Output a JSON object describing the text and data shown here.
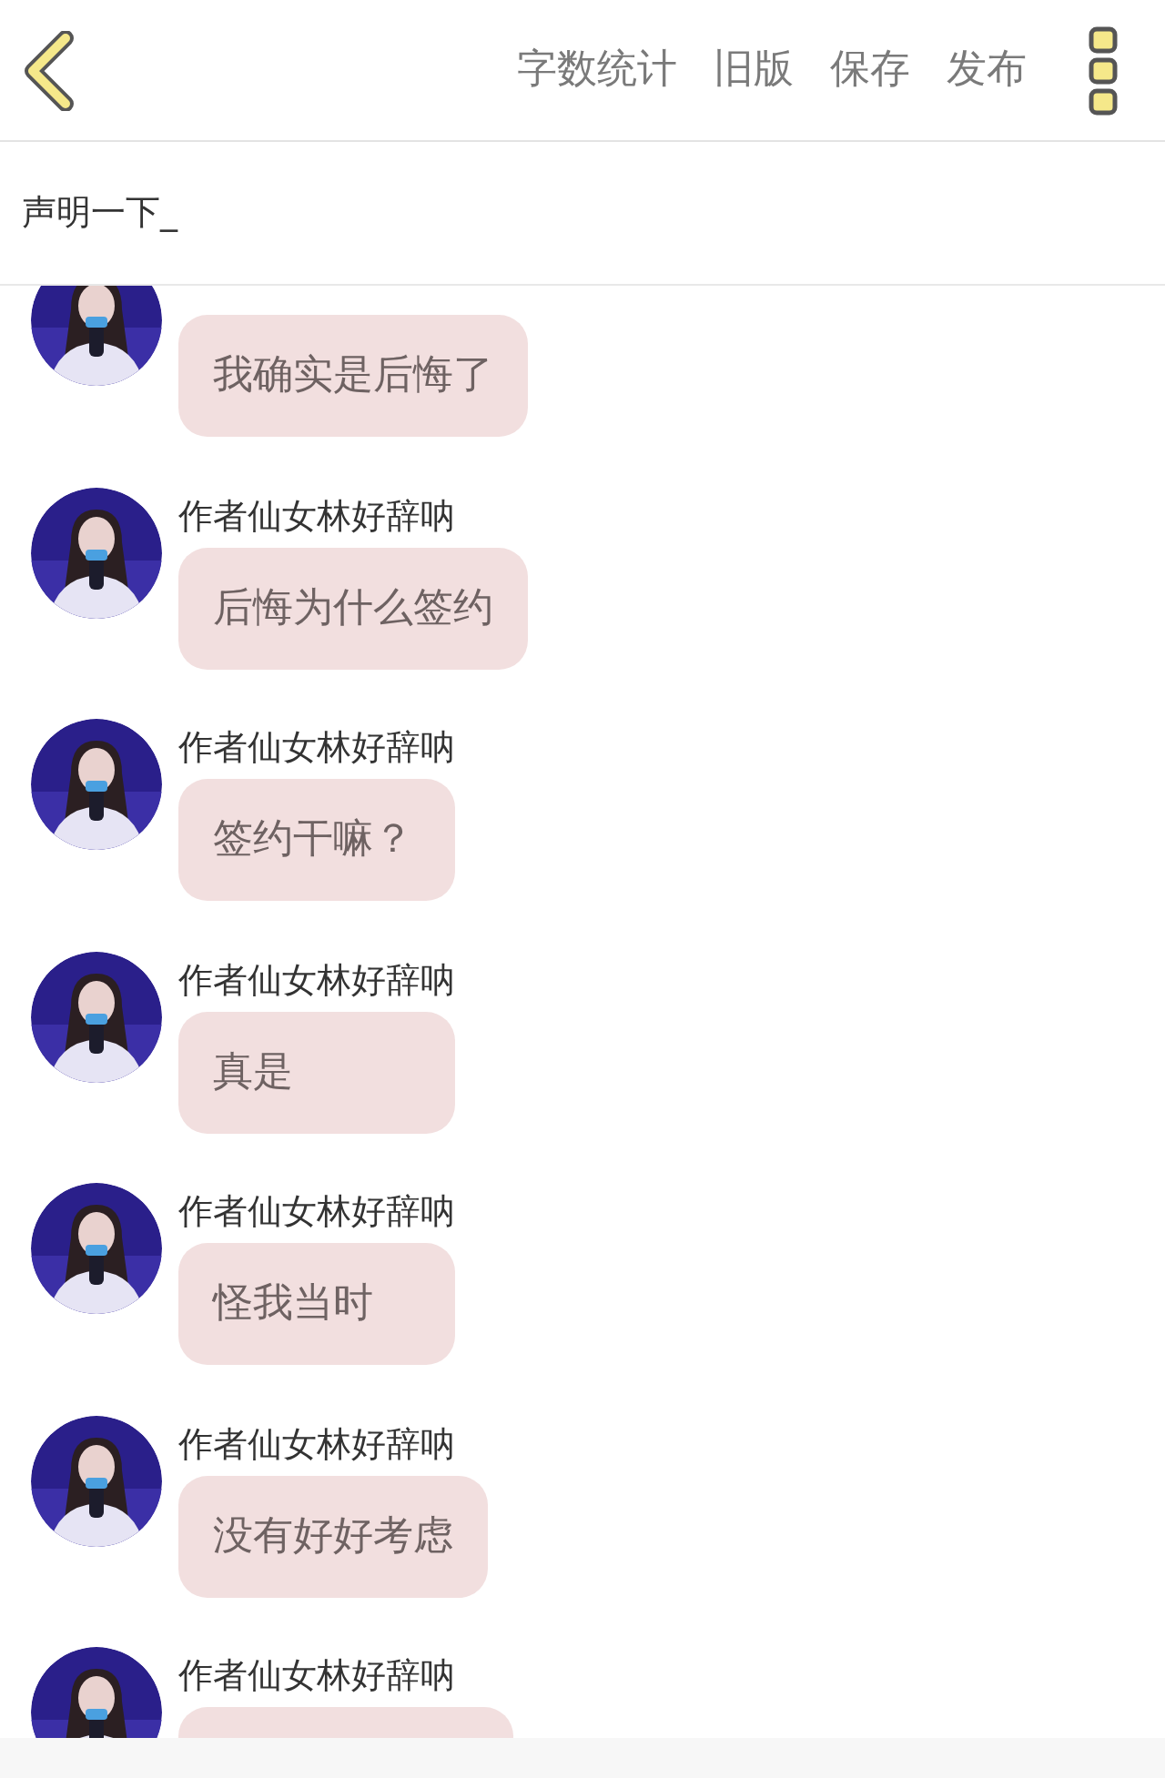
{
  "header": {
    "actions": [
      "字数统计",
      "旧版",
      "保存",
      "发布"
    ]
  },
  "title_field": {
    "value": "声明一下_"
  },
  "messages": [
    {
      "text": "我确实是后悔了"
    },
    {
      "author": "作者仙女林好辞呐",
      "text": "后悔为什么签约"
    },
    {
      "author": "作者仙女林好辞呐",
      "text": "签约干嘛？"
    },
    {
      "author": "作者仙女林好辞呐",
      "text": "真是"
    },
    {
      "author": "作者仙女林好辞呐",
      "text": "怪我当时"
    },
    {
      "author": "作者仙女林好辞呐",
      "text": "没有好好考虑"
    },
    {
      "author": "作者仙女林好辞呐"
    }
  ]
}
